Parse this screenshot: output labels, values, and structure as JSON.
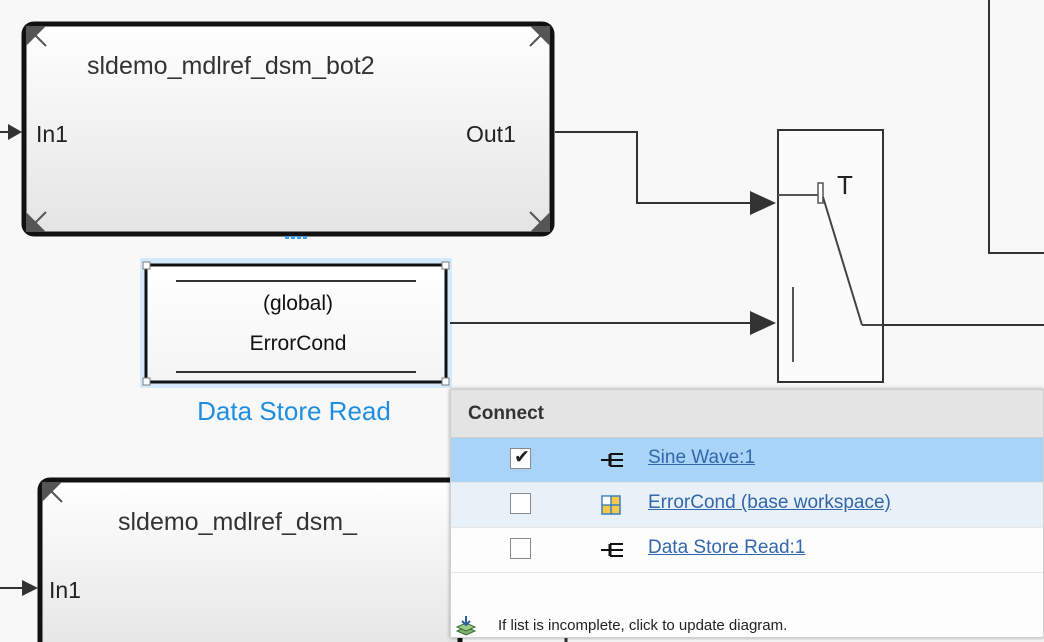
{
  "blocks": {
    "top_model": {
      "title": "sldemo_mdlref_dsm_bot2",
      "in_port": "In1",
      "out_port": "Out1"
    },
    "data_store_read": {
      "line1": "(global)",
      "line2": "ErrorCond",
      "label": "Data Store Read"
    },
    "bottom_model": {
      "title": "sldemo_mdlref_dsm_",
      "in_port": "In1"
    },
    "switch": {
      "port_label": "T"
    }
  },
  "connect_popup": {
    "header": "Connect",
    "items": [
      {
        "label": "Sine Wave:1",
        "checked": true,
        "icon": "signal-port-icon",
        "selected": true
      },
      {
        "label": "ErrorCond (base workspace)",
        "checked": false,
        "icon": "workspace-grid-icon",
        "selected": false
      },
      {
        "label": "Data Store Read:1",
        "checked": false,
        "icon": "signal-port-icon",
        "selected": false
      }
    ],
    "footer": "If list is incomplete, click to update diagram.",
    "footer_icon": "update-diagram-icon"
  },
  "colors": {
    "canvas_bg": "#f8f8f8",
    "selection_accent": "#1e8fe0",
    "selected_row": "#a8d4f7",
    "link": "#3366aa"
  }
}
